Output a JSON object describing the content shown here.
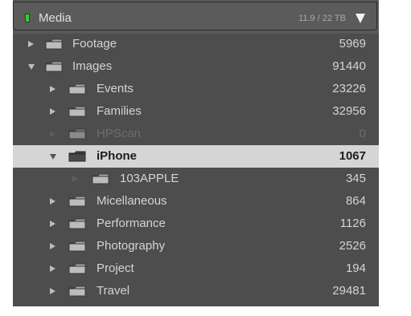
{
  "header": {
    "title": "Media",
    "capacity": "11.9 / 22 TB"
  },
  "folders": [
    {
      "label": "Footage",
      "count": "5969",
      "depth": 0,
      "state": "collapsed"
    },
    {
      "label": "Images",
      "count": "91440",
      "depth": 0,
      "state": "expanded"
    },
    {
      "label": "Events",
      "count": "23226",
      "depth": 1,
      "state": "collapsed"
    },
    {
      "label": "Families",
      "count": "32956",
      "depth": 1,
      "state": "collapsed"
    },
    {
      "label": "HPScan",
      "count": "0",
      "depth": 1,
      "state": "collapsed",
      "dimmed": true
    },
    {
      "label": "iPhone",
      "count": "1067",
      "depth": 1,
      "state": "expanded",
      "selected": true
    },
    {
      "label": "103APPLE",
      "count": "345",
      "depth": 2,
      "state": "collapsed",
      "dimmed_arrow": true
    },
    {
      "label": "Micellaneous",
      "count": "864",
      "depth": 1,
      "state": "collapsed"
    },
    {
      "label": "Performance",
      "count": "1126",
      "depth": 1,
      "state": "collapsed"
    },
    {
      "label": "Photography",
      "count": "2526",
      "depth": 1,
      "state": "collapsed"
    },
    {
      "label": "Project",
      "count": "194",
      "depth": 1,
      "state": "collapsed"
    },
    {
      "label": "Travel",
      "count": "29481",
      "depth": 1,
      "state": "collapsed"
    }
  ],
  "colors": {
    "panel_bg": "#4d4d4d",
    "selected_row_bg": "#d5d5d5",
    "volume_indicator": "#39c93c"
  },
  "icons": {
    "folder": "folder-icon",
    "expand": "disclosure-triangle-icon",
    "menu": "chevron-down-icon"
  }
}
